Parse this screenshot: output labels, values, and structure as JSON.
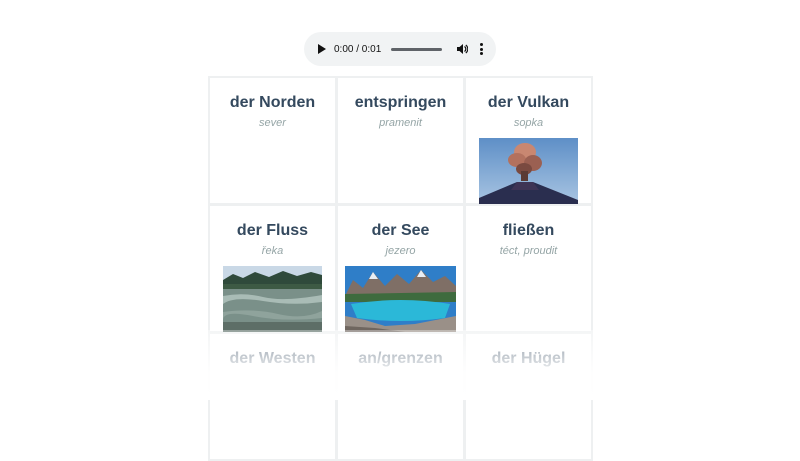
{
  "player": {
    "time_display": "0:00 / 0:01",
    "progress": 0,
    "icons": [
      "play-icon",
      "volume-icon",
      "more-icon"
    ]
  },
  "cards": [
    {
      "word": "der Norden",
      "translation": "sever",
      "image": null
    },
    {
      "word": "entspringen",
      "translation": "pramenit",
      "image": null
    },
    {
      "word": "der Vulkan",
      "translation": "sopka",
      "image": "volcano-image"
    },
    {
      "word": "der Fluss",
      "translation": "řeka",
      "image": "river-image"
    },
    {
      "word": "der See",
      "translation": "jezero",
      "image": "lake-image"
    },
    {
      "word": "fließen",
      "translation": "téct, proudit",
      "image": null
    },
    {
      "word": "der Westen",
      "translation": "",
      "image": null
    },
    {
      "word": "an/grenzen",
      "translation": "",
      "image": null
    },
    {
      "word": "der Hügel",
      "translation": "",
      "image": null
    }
  ],
  "colors": {
    "word": "#34495e",
    "translation": "#95a5a6",
    "card_border": "#eef0f1",
    "player_bg": "#f1f3f4"
  }
}
